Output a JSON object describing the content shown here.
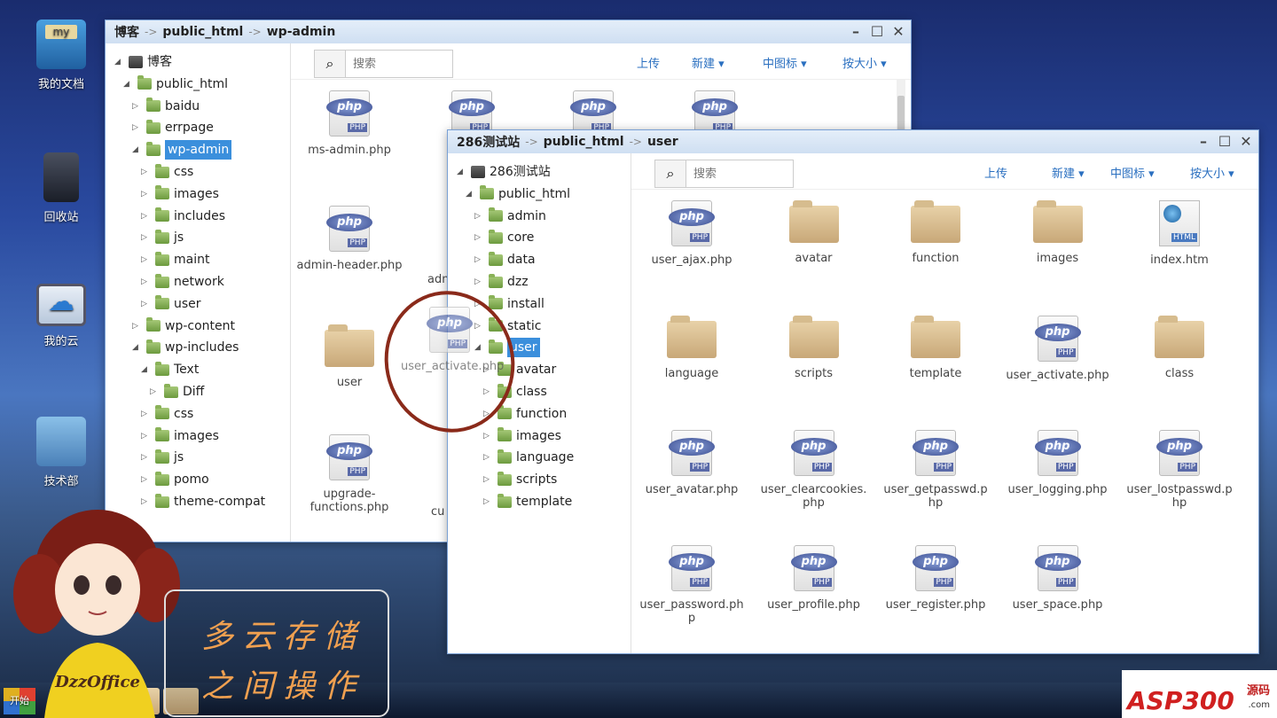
{
  "desktop": {
    "icons": [
      {
        "label": "我的文档",
        "icon": "my-documents-icon"
      },
      {
        "label": "回收站",
        "icon": "recycle-bin-icon"
      },
      {
        "label": "我的云",
        "icon": "my-cloud-icon"
      },
      {
        "label": "技术部",
        "icon": "tech-dept-icon"
      }
    ]
  },
  "window_back": {
    "breadcrumb": [
      "博客",
      "public_html",
      "wp-admin"
    ],
    "tree": [
      {
        "label": "博客",
        "level": 0,
        "type": "pc",
        "open": true
      },
      {
        "label": "public_html",
        "level": 1,
        "open": true
      },
      {
        "label": "baidu",
        "level": 2
      },
      {
        "label": "errpage",
        "level": 2
      },
      {
        "label": "wp-admin",
        "level": 2,
        "open": true,
        "selected": true
      },
      {
        "label": "css",
        "level": 3
      },
      {
        "label": "images",
        "level": 3
      },
      {
        "label": "includes",
        "level": 3
      },
      {
        "label": "js",
        "level": 3
      },
      {
        "label": "maint",
        "level": 3
      },
      {
        "label": "network",
        "level": 3
      },
      {
        "label": "user",
        "level": 3
      },
      {
        "label": "wp-content",
        "level": 2
      },
      {
        "label": "wp-includes",
        "level": 2,
        "open": true
      },
      {
        "label": "Text",
        "level": 3,
        "open": true
      },
      {
        "label": "Diff",
        "level": 4
      },
      {
        "label": "css",
        "level": 3
      },
      {
        "label": "images",
        "level": 3
      },
      {
        "label": "js",
        "level": 3
      },
      {
        "label": "pomo",
        "level": 3
      },
      {
        "label": "theme-compat",
        "level": 3
      }
    ],
    "search_placeholder": "搜索",
    "toolbar": {
      "upload": "上传",
      "new": "新建",
      "view": "中图标",
      "sort": "按大小"
    },
    "files": [
      {
        "name": "ms-admin.php",
        "type": "php"
      },
      {
        "name": "admin-header.php",
        "type": "php"
      },
      {
        "name": "user",
        "type": "folder"
      },
      {
        "name": "upgrade-functions.php",
        "type": "php"
      }
    ],
    "partial_labels": [
      "adm",
      "cu"
    ]
  },
  "window_front": {
    "breadcrumb": [
      "286测试站",
      "public_html",
      "user"
    ],
    "tree": [
      {
        "label": "286测试站",
        "level": 0,
        "type": "pc",
        "open": true
      },
      {
        "label": "public_html",
        "level": 1,
        "open": true
      },
      {
        "label": "admin",
        "level": 2
      },
      {
        "label": "core",
        "level": 2
      },
      {
        "label": "data",
        "level": 2
      },
      {
        "label": "dzz",
        "level": 2
      },
      {
        "label": "install",
        "level": 2
      },
      {
        "label": "static",
        "level": 2
      },
      {
        "label": "user",
        "level": 2,
        "open": true,
        "selected": true
      },
      {
        "label": "avatar",
        "level": 3
      },
      {
        "label": "class",
        "level": 3
      },
      {
        "label": "function",
        "level": 3
      },
      {
        "label": "images",
        "level": 3
      },
      {
        "label": "language",
        "level": 3
      },
      {
        "label": "scripts",
        "level": 3
      },
      {
        "label": "template",
        "level": 3
      }
    ],
    "search_placeholder": "搜索",
    "toolbar": {
      "upload": "上传",
      "new": "新建",
      "view": "中图标",
      "sort": "按大小"
    },
    "files": [
      {
        "name": "user_ajax.php",
        "type": "php"
      },
      {
        "name": "avatar",
        "type": "folder"
      },
      {
        "name": "function",
        "type": "folder"
      },
      {
        "name": "images",
        "type": "folder"
      },
      {
        "name": "index.htm",
        "type": "html"
      },
      {
        "name": "language",
        "type": "folder"
      },
      {
        "name": "scripts",
        "type": "folder"
      },
      {
        "name": "template",
        "type": "folder"
      },
      {
        "name": "user_activate.php",
        "type": "php"
      },
      {
        "name": "class",
        "type": "folder"
      },
      {
        "name": "user_avatar.php",
        "type": "php"
      },
      {
        "name": "user_clearcookies.php",
        "type": "php"
      },
      {
        "name": "user_getpasswd.php",
        "type": "php"
      },
      {
        "name": "user_logging.php",
        "type": "php"
      },
      {
        "name": "user_lostpasswd.php",
        "type": "php"
      },
      {
        "name": "user_password.php",
        "type": "php"
      },
      {
        "name": "user_profile.php",
        "type": "php"
      },
      {
        "name": "user_register.php",
        "type": "php"
      },
      {
        "name": "user_space.php",
        "type": "php"
      }
    ]
  },
  "drag_ghost": {
    "name": "user_activate.php"
  },
  "banner": {
    "line1": "多云存储",
    "line2": "之间操作"
  },
  "mascot_text": "DzzOffice",
  "taskbar": {
    "start_label": "开始"
  },
  "watermark": {
    "brand": "ASP300",
    "suffix": "源码",
    "domain": ".com"
  },
  "colors": {
    "accent": "#2a6fc0",
    "selection": "#3b8fdc",
    "annotation": "#8a2a1a"
  }
}
